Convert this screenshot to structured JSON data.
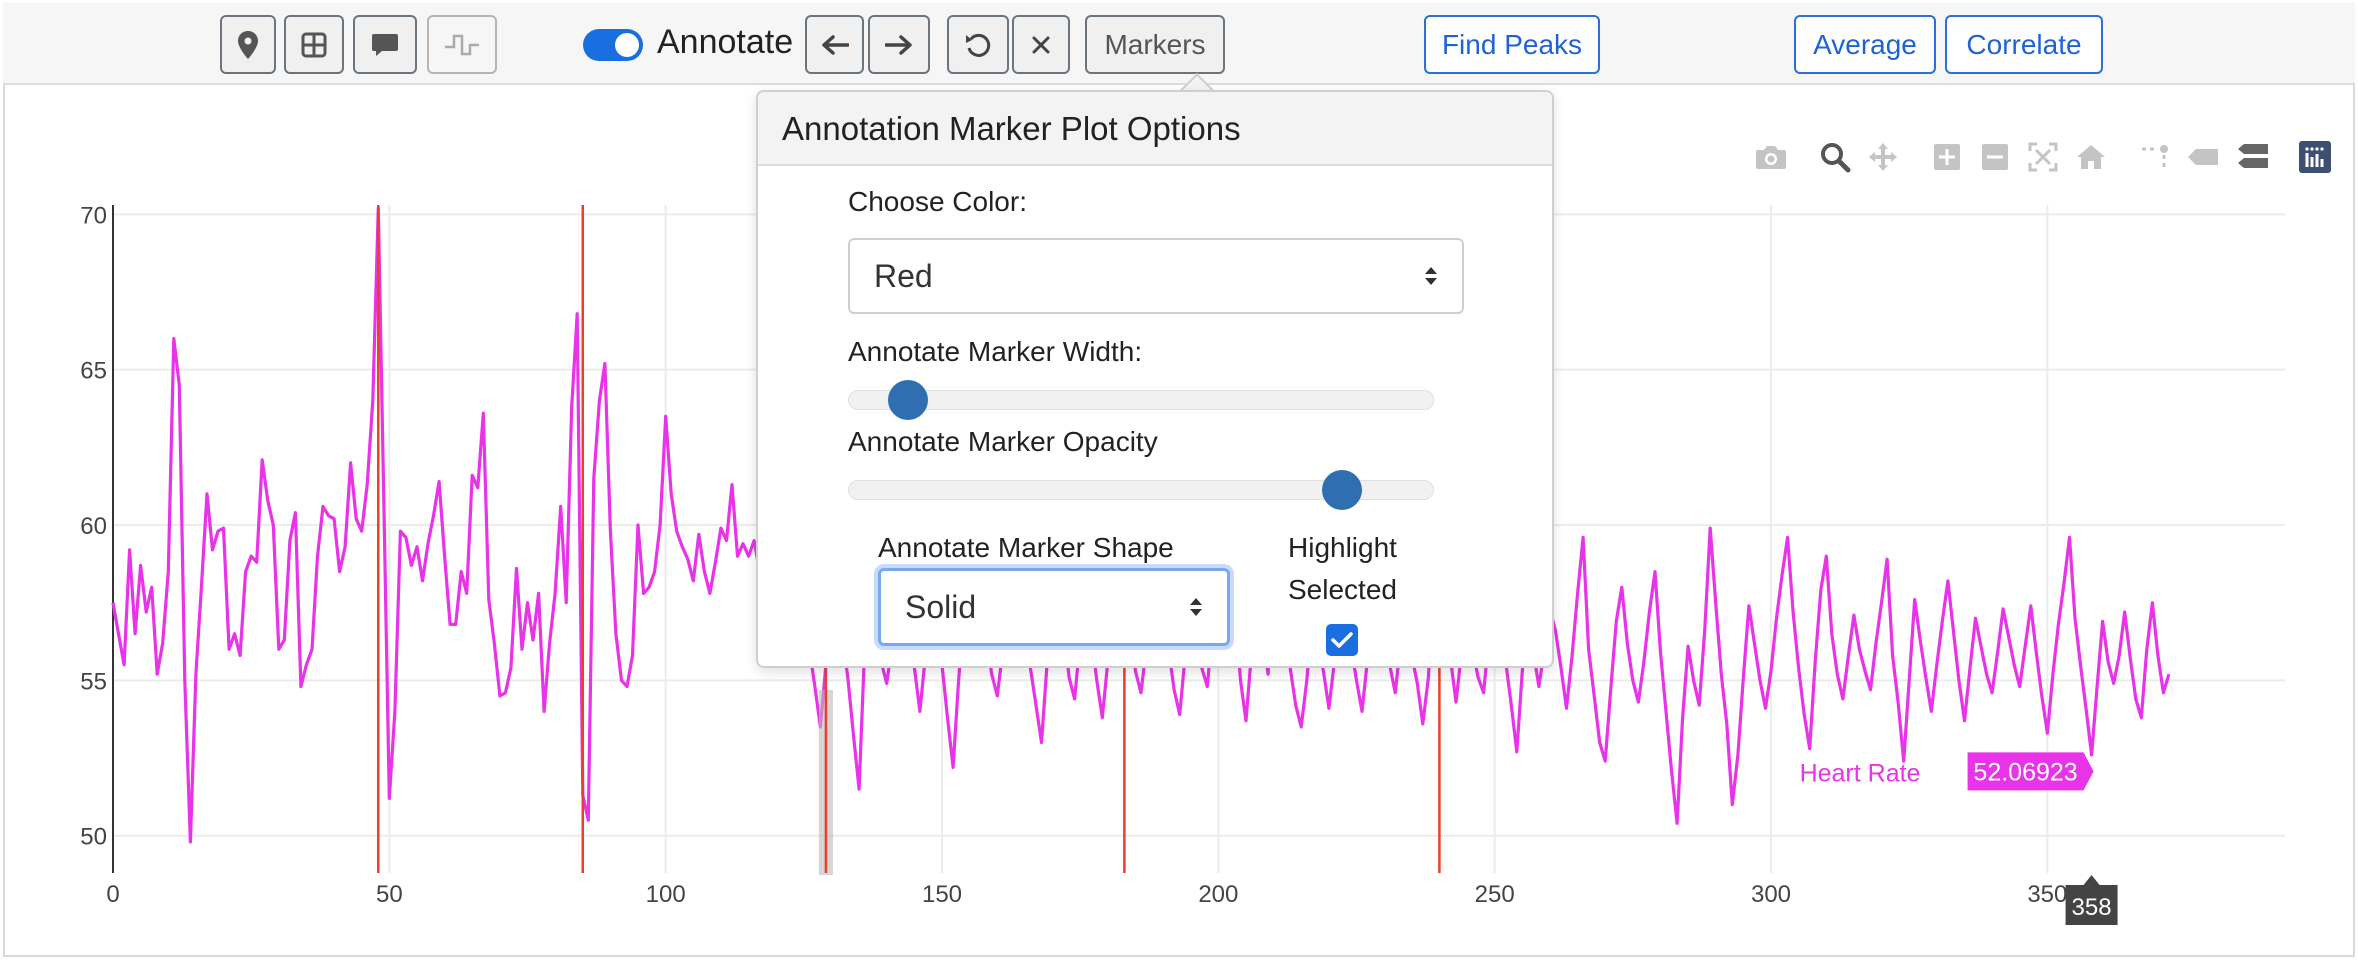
{
  "toolbar": {
    "icon_buttons": [
      {
        "name": "map-pin-icon"
      },
      {
        "name": "grid-icon"
      },
      {
        "name": "comment-icon"
      },
      {
        "name": "step-wave-icon"
      }
    ],
    "annotate_label": "Annotate",
    "annotate_on": true,
    "markers_label": "Markers",
    "find_peaks_label": "Find Peaks",
    "average_label": "Average",
    "correlate_label": "Correlate"
  },
  "modebar": [
    "camera-icon",
    "zoom-icon",
    "pan-icon",
    "zoom-in-icon",
    "zoom-out-icon",
    "autoscale-icon",
    "reset-axes-icon",
    "spike-lines-icon",
    "hover-closest-icon",
    "hover-compare-icon",
    "plotly-logo-icon"
  ],
  "popover": {
    "title": "Annotation Marker Plot Options",
    "color_label": "Choose Color:",
    "color_value": "Red",
    "width_label": "Annotate Marker Width:",
    "width_level": 0.1,
    "opacity_label": "Annotate Marker Opacity",
    "opacity_level": 0.85,
    "shape_label": "Annotate Marker Shape",
    "shape_value": "Solid",
    "highlight_label_line1": "Highlight",
    "highlight_label_line2": "Selected",
    "highlight_checked": true
  },
  "colors": {
    "line": "#e833e8",
    "marker": "#e8402a",
    "accent": "#1a6fe0"
  },
  "chart_data": {
    "type": "line",
    "series": [
      {
        "name": "Heart Rate",
        "x_start": 0,
        "x_step": 1,
        "values": [
          57.5,
          56.5,
          55.5,
          59.2,
          56.5,
          58.7,
          57.2,
          58.0,
          55.2,
          56.2,
          58.5,
          66.0,
          64.5,
          55.0,
          49.8,
          55.2,
          58.0,
          61.0,
          59.2,
          59.8,
          59.9,
          56.0,
          56.5,
          55.8,
          58.5,
          59.0,
          58.8,
          62.1,
          60.8,
          60.0,
          56.0,
          56.3,
          59.5,
          60.4,
          54.8,
          55.5,
          56.0,
          59.0,
          60.6,
          60.3,
          60.2,
          58.5,
          59.3,
          62.0,
          60.2,
          59.8,
          61.3,
          64.0,
          70.2,
          60.8,
          51.2,
          54.0,
          59.8,
          59.6,
          58.7,
          59.3,
          58.2,
          59.4,
          60.3,
          61.4,
          59.0,
          56.8,
          56.8,
          58.5,
          57.8,
          61.6,
          61.2,
          63.6,
          57.6,
          56.2,
          54.5,
          54.6,
          55.4,
          58.6,
          56.0,
          57.5,
          56.3,
          57.8,
          54.0,
          56.2,
          57.8,
          60.6,
          57.5,
          63.8,
          66.8,
          51.3,
          50.5,
          61.5,
          64.0,
          65.2,
          59.8,
          56.5,
          55.0,
          54.8,
          55.8,
          60.0,
          57.8,
          58.0,
          58.5,
          60.0,
          63.5,
          61.0,
          59.8,
          59.3,
          58.9,
          58.2,
          59.7,
          58.5,
          57.8,
          58.8,
          59.9,
          59.5,
          61.3,
          59.0,
          59.4,
          59.0
        ],
        "values_visible_note": ""
      }
    ],
    "x_ticks": [
      0,
      50,
      100,
      150,
      200,
      250,
      300,
      350
    ],
    "y_ticks": [
      50,
      55,
      60,
      65,
      70
    ],
    "xlim": [
      0,
      393
    ],
    "ylim": [
      48.8,
      70.3
    ],
    "markers_x": [
      48,
      85,
      129,
      183,
      240
    ],
    "hover": {
      "label": "Heart Rate",
      "value": "52.06923",
      "x_label": "358"
    }
  }
}
